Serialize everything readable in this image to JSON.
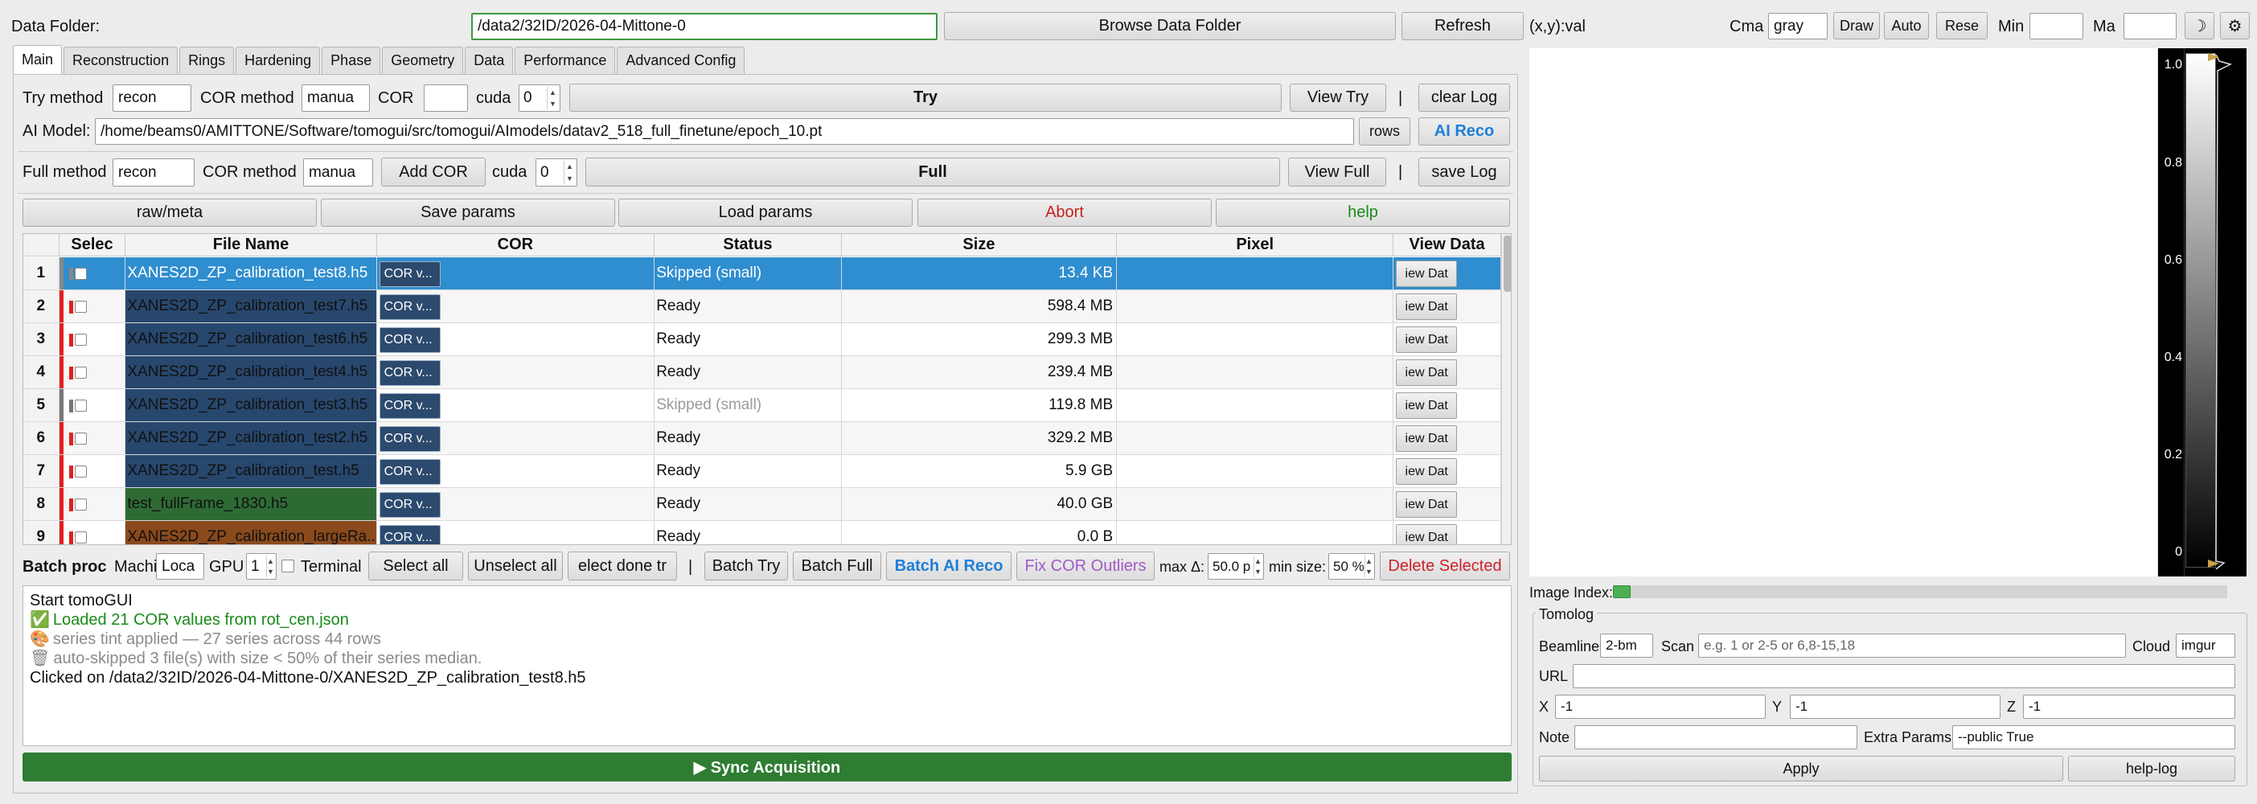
{
  "top": {
    "data_folder_label": "Data Folder:",
    "data_folder_value": "/data2/32ID/2026-04-Mittone-0",
    "browse_label": "Browse Data Folder",
    "refresh_label": "Refresh",
    "xy_readout": "(x,y):val",
    "cmap_label": "Cma",
    "cmap_value": "gray",
    "draw_label": "Draw",
    "auto_label": "Auto",
    "reset_label": "Rese",
    "min_label": "Min",
    "max_label": "Ma"
  },
  "tabs": [
    "Main",
    "Reconstruction",
    "Rings",
    "Hardening",
    "Phase",
    "Geometry",
    "Data",
    "Performance",
    "Advanced Config"
  ],
  "try_row": {
    "try_method_label": "Try method",
    "try_method_value": "recon",
    "cor_method_label": "COR method",
    "cor_method_value": "manua",
    "cor_label": "COR",
    "cor_value": "",
    "cuda_label": "cuda",
    "cuda_value": "0",
    "try_button": "Try",
    "view_try": "View Try",
    "pipe": "|",
    "clear_log": "clear Log"
  },
  "ai_row": {
    "label": "AI Model:",
    "path": "/home/beams0/AMITTONE/Software/tomogui/src/tomogui/AImodels/datav2_518_full_finetune/epoch_10.pt",
    "browse": "rows",
    "ai_reco": "AI Reco"
  },
  "full_row": {
    "full_method_label": "Full method",
    "full_method_value": "recon",
    "cor_method_label": "COR method",
    "cor_method_value": "manua",
    "add_cor": "Add COR",
    "cuda_label": "cuda",
    "cuda_value": "0",
    "full_button": "Full",
    "view_full": "View Full",
    "pipe": "|",
    "save_log": "save Log"
  },
  "action_row": [
    "raw/meta",
    "Save params",
    "Load params",
    "Abort",
    "help"
  ],
  "colors": {
    "abort": "#c81e1e",
    "help": "#1a8a1a",
    "ai_blue": "#1e7fd8",
    "selected_row": "#2f8ecf",
    "sync_green": "#2e7d32",
    "fix_purple": "#a05ac8",
    "delete_red": "#d0202a"
  },
  "table": {
    "headers": [
      "Selec",
      "File Name",
      "COR",
      "Status",
      "Size",
      "Pixel",
      "View Data"
    ],
    "cor_button": "COR v...",
    "view_button": "iew Dat",
    "rows": [
      {
        "num": "1",
        "name": "XANES2D_ZP_calibration_test8.h5",
        "status": "Skipped (small)",
        "size": "13.4 KB",
        "tint": "#2f8ecf",
        "mark": "#888888",
        "selected": true,
        "skipped": false
      },
      {
        "num": "2",
        "name": "XANES2D_ZP_calibration_test7.h5",
        "status": "Ready",
        "size": "598.4 MB",
        "tint": "#27476d",
        "mark": "#e02020",
        "selected": false,
        "skipped": false
      },
      {
        "num": "3",
        "name": "XANES2D_ZP_calibration_test6.h5",
        "status": "Ready",
        "size": "299.3 MB",
        "tint": "#27476d",
        "mark": "#e02020",
        "selected": false,
        "skipped": false
      },
      {
        "num": "4",
        "name": "XANES2D_ZP_calibration_test4.h5",
        "status": "Ready",
        "size": "239.4 MB",
        "tint": "#27476d",
        "mark": "#e02020",
        "selected": false,
        "skipped": false
      },
      {
        "num": "5",
        "name": "XANES2D_ZP_calibration_test3.h5",
        "status": "Skipped (small)",
        "size": "119.8 MB",
        "tint": "#27476d",
        "mark": "#777777",
        "selected": false,
        "skipped": true
      },
      {
        "num": "6",
        "name": "XANES2D_ZP_calibration_test2.h5",
        "status": "Ready",
        "size": "329.2 MB",
        "tint": "#27476d",
        "mark": "#e02020",
        "selected": false,
        "skipped": false
      },
      {
        "num": "7",
        "name": "XANES2D_ZP_calibration_test.h5",
        "status": "Ready",
        "size": "5.9 GB",
        "tint": "#27476d",
        "mark": "#e02020",
        "selected": false,
        "skipped": false
      },
      {
        "num": "8",
        "name": "test_fullFrame_1830.h5",
        "status": "Ready",
        "size": "40.0 GB",
        "tint": "#2e6b34",
        "mark": "#e02020",
        "selected": false,
        "skipped": false
      },
      {
        "num": "9",
        "name": "XANES2D_ZP_calibration_largeRa...",
        "status": "Ready",
        "size": "0.0 B",
        "tint": "#8a4a1c",
        "mark": "#e02020",
        "selected": false,
        "skipped": false
      }
    ]
  },
  "batch": {
    "label": "Batch proc",
    "machine_label": "Machi",
    "machine_value": "Loca",
    "gpu_label": "GPU",
    "gpu_value": "1",
    "terminal_label": "Terminal",
    "select_all": "Select all",
    "unselect_all": "Unselect all",
    "select_done": "elect done tr",
    "pipe": "|",
    "batch_try": "Batch Try",
    "batch_full": "Batch Full",
    "batch_ai": "Batch AI Reco",
    "fix_cor": "Fix COR Outliers",
    "max_delta_label": "max Δ:",
    "max_delta_value": "50.0 p",
    "min_size_label": "min size:",
    "min_size_value": "50 %",
    "delete": "Delete Selected"
  },
  "log": [
    {
      "icon": "",
      "text": "Start tomoGUI",
      "color": "#111111"
    },
    {
      "icon": "✅",
      "text": "Loaded 21 COR values from rot_cen.json",
      "color": "#1a8a1a"
    },
    {
      "icon": "🎨",
      "text": "series tint applied — 27 series across 44 rows",
      "color": "#8a8a8a"
    },
    {
      "icon": "🗑",
      "text": "auto-skipped 3 file(s) with size < 50% of their series median.",
      "color": "#8a8a8a"
    },
    {
      "icon": "",
      "text": "Clicked on /data2/32ID/2026-04-Mittone-0/XANES2D_ZP_calibration_test8.h5",
      "color": "#111111"
    }
  ],
  "sync_label": "▶  Sync Acquisition",
  "colorbar": {
    "ticks": [
      "1.0",
      "0.8",
      "0.6",
      "0.4",
      "0.2",
      "0"
    ]
  },
  "image_index_label": "Image Index:",
  "tomolog": {
    "title": "Tomolog",
    "beamline_label": "Beamline",
    "beamline_value": "2-bm",
    "scan_label": "Scan",
    "scan_placeholder": "e.g. 1 or 2-5 or 6,8-15,18",
    "cloud_label": "Cloud",
    "cloud_value": "imgur",
    "url_label": "URL",
    "url_value": "",
    "x_label": "X",
    "x_value": "-1",
    "y_label": "Y",
    "y_value": "-1",
    "z_label": "Z",
    "z_value": "-1",
    "note_label": "Note",
    "note_value": "",
    "extra_label": "Extra Params",
    "extra_value": "--public True",
    "apply": "Apply",
    "help_log": "help-log"
  }
}
